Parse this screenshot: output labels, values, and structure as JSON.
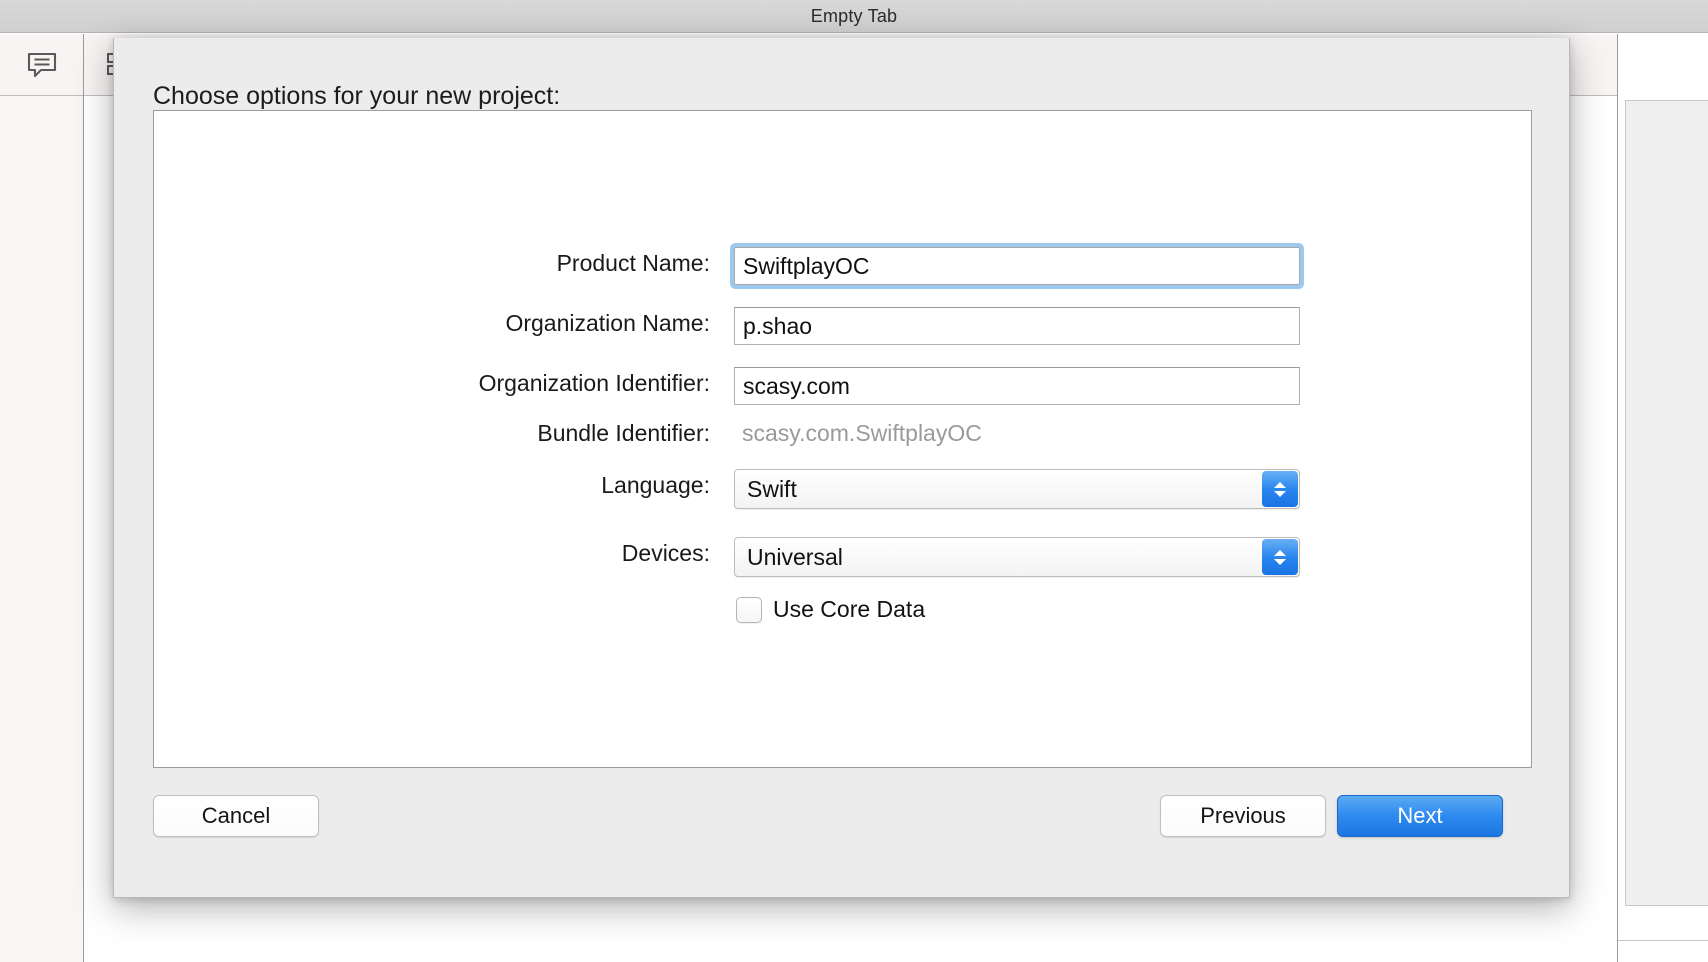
{
  "window": {
    "title": "Empty Tab",
    "toolbar_icons": [
      {
        "name": "comment-bubble-icon"
      },
      {
        "name": "grid-layout-icon"
      }
    ]
  },
  "dialog": {
    "heading": "Choose options for your new project:",
    "fields": [
      {
        "label": "Product Name:",
        "value": "SwiftplayOC",
        "type": "text",
        "focused": true
      },
      {
        "label": "Organization Name:",
        "value": "p.shao",
        "type": "text",
        "focused": false
      },
      {
        "label": "Organization Identifier:",
        "value": "scasy.com",
        "type": "text",
        "focused": false
      },
      {
        "label": "Bundle Identifier:",
        "value": "scasy.com.SwiftplayOC",
        "type": "static",
        "focused": false
      },
      {
        "label": "Language:",
        "value": "Swift",
        "type": "popup",
        "focused": false
      },
      {
        "label": "Devices:",
        "value": "Universal",
        "type": "popup",
        "focused": false
      }
    ],
    "checkbox": {
      "label": "Use Core Data",
      "checked": false
    },
    "buttons": {
      "cancel": "Cancel",
      "previous": "Previous",
      "next": "Next"
    }
  },
  "colors": {
    "accent_blue": "#2f8bef",
    "focus_ring": "#9ec9ef",
    "dialog_bg": "#ececec",
    "titlebar_bg": "#d4d4d4",
    "disabled_text": "#9a9a9a"
  }
}
